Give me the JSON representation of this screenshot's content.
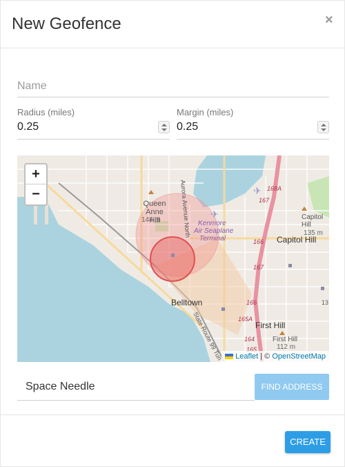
{
  "dialog": {
    "title": "New Geofence",
    "close_glyph": "×"
  },
  "form": {
    "name": {
      "placeholder": "Name",
      "value": ""
    },
    "radius": {
      "label": "Radius (miles)",
      "value": "0.25"
    },
    "margin": {
      "label": "Margin (miles)",
      "value": "0.25"
    },
    "address": {
      "value": "Space Needle"
    },
    "find_button": "FIND ADDRESS"
  },
  "map": {
    "zoom_in": "+",
    "zoom_out": "−",
    "labels": {
      "queen_anne_hill": "Queen Anne Hill",
      "qah_elev": "144 m",
      "kenmore": "Kenmore",
      "air_seaplane": "Air Seaplane",
      "terminal": "Terminal",
      "capitol_hill": "Capitol Hill",
      "capitol_hill_small": "Capitol Hill",
      "ch_elev": "135 m",
      "belltown": "Belltown",
      "first_hill": "First Hill",
      "first_hill_small": "First Hill",
      "fh_elev": "112 m",
      "aurora": "Aurora Avenue North",
      "state_route": "State Route 99 Tun",
      "r_168a": "168A",
      "r_167a": "167",
      "r_167b": "167",
      "r_166a": "166",
      "r_166b": "166",
      "r_165a": "165A",
      "r_164": "164",
      "r_165": "165",
      "r_13": "13"
    },
    "attribution": {
      "leaflet": "Leaflet",
      "separator": " | © ",
      "osm": "OpenStreetMap"
    },
    "geofence_colors": {
      "outer": "#f28c8c",
      "inner": "#e86060"
    }
  },
  "footer": {
    "create_button": "CREATE"
  }
}
